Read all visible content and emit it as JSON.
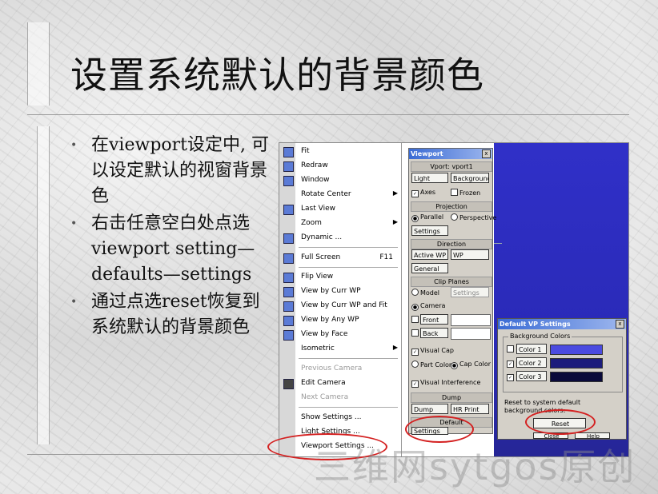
{
  "slide": {
    "title": "设置系统默认的背景颜色",
    "bullets": [
      "在viewport设定中, 可以设定默认的视窗背景色",
      "右击任意空白处点选viewport setting—defaults—settings",
      "通过点选reset恢复到系统默认的背景颜色"
    ],
    "bullet_glyph": "•"
  },
  "context_menu": {
    "items": [
      {
        "label": "Fit",
        "icon": "fit-icon"
      },
      {
        "label": "Redraw",
        "icon": "redraw-icon"
      },
      {
        "label": "Window",
        "icon": "window-icon"
      },
      {
        "label": "Rotate Center",
        "submenu": true
      },
      {
        "label": "Last View",
        "icon": "last-view-icon"
      },
      {
        "label": "Zoom",
        "submenu": true
      },
      {
        "label": "Dynamic ...",
        "icon": "dynamic-icon"
      },
      {
        "label": "Full Screen",
        "shortcut": "F11",
        "icon": "full-screen-icon"
      },
      {
        "label": "Flip View",
        "icon": "flip-view-icon"
      },
      {
        "label": "View by Curr WP",
        "icon": "curr-wp-icon"
      },
      {
        "label": "View by Curr WP and Fit",
        "icon": "curr-wp-fit-icon"
      },
      {
        "label": "View by Any WP",
        "icon": "any-wp-icon"
      },
      {
        "label": "View by Face",
        "icon": "face-icon"
      },
      {
        "label": "Isometric",
        "submenu": true
      },
      {
        "label": "Previous Camera",
        "disabled": true
      },
      {
        "label": "Edit Camera",
        "icon": "camera-icon"
      },
      {
        "label": "Next Camera",
        "disabled": true
      },
      {
        "label": "Show Settings ..."
      },
      {
        "label": "Light Settings ..."
      },
      {
        "label": "Viewport Settings ..."
      }
    ],
    "submenu_arrow": "▶"
  },
  "viewport_panel": {
    "title": "Viewport",
    "close": "x",
    "vport_label": "Vport: vport1",
    "light_btn": "Light",
    "background_btn": "Background",
    "axes_label": "Axes",
    "axes_checked": true,
    "frozen_label": "Frozen",
    "frozen_checked": false,
    "projection_header": "Projection",
    "parallel_label": "Parallel",
    "perspective_label": "Perspective",
    "projection_selected": "Parallel",
    "proj_settings_btn": "Settings",
    "direction_header": "Direction",
    "active_wp_btn": "Active WP",
    "wp_btn": "WP",
    "general_btn": "General",
    "clip_header": "Clip Planes",
    "model_label": "Model",
    "clip_settings_btn": "Settings",
    "camera_label": "Camera",
    "clip_selected": "Camera",
    "front_label": "Front",
    "back_label": "Back",
    "visual_cap_label": "Visual Cap",
    "visual_cap_checked": true,
    "part_color_label": "Part Color",
    "cap_color_label": "Cap Color",
    "cap_selected": "Cap Color",
    "visual_interference_label": "Visual Interference",
    "visual_interference_checked": true,
    "dump_header": "Dump",
    "dump_btn": "Dump",
    "hr_print_btn": "HR Print",
    "default_header": "Default",
    "default_settings_btn": "Settings",
    "check_glyph": "✓",
    "radio_glyph": "●"
  },
  "default_vp_dialog": {
    "title": "Default VP Settings",
    "close": "x",
    "group_label": "Background Colors",
    "colors": [
      {
        "label": "Color 1",
        "checked": false,
        "swatch": "#4b4be0"
      },
      {
        "label": "Color 2",
        "checked": true,
        "swatch": "#1c1c7c"
      },
      {
        "label": "Color 3",
        "checked": true,
        "swatch": "#0a0a3a"
      }
    ],
    "reset_text": "Reset to system default background colors:",
    "reset_btn": "Reset",
    "close_btn": "Close",
    "help_btn": "Help"
  },
  "watermark": "三维网sytgos原创",
  "colors": {
    "viewport_blue": "#2a2ab8",
    "titlebar": "#3a6bd4",
    "highlight_red": "#d42020"
  }
}
